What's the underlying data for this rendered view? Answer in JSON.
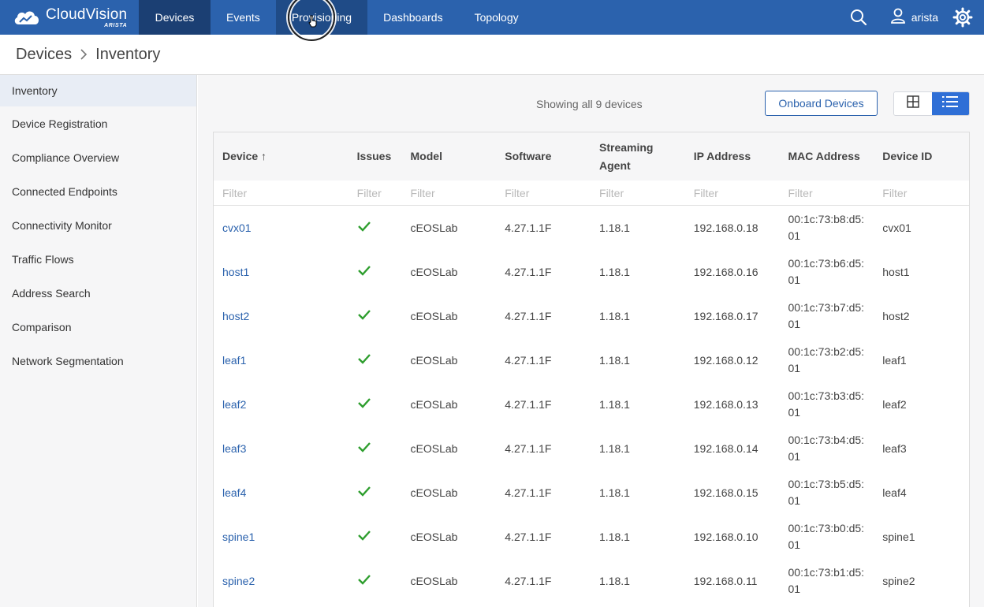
{
  "app": {
    "name": "CloudVision",
    "sub": "ARISTA"
  },
  "nav": {
    "tabs": [
      {
        "label": "Devices"
      },
      {
        "label": "Events"
      },
      {
        "label": "Provisioning"
      },
      {
        "label": "Dashboards"
      },
      {
        "label": "Topology"
      }
    ],
    "active": "Devices",
    "user": "arista"
  },
  "breadcrumb": {
    "section": "Devices",
    "page": "Inventory"
  },
  "sidebar": {
    "items": [
      {
        "label": "Inventory"
      },
      {
        "label": "Device Registration"
      },
      {
        "label": "Compliance Overview"
      },
      {
        "label": "Connected Endpoints"
      },
      {
        "label": "Connectivity Monitor"
      },
      {
        "label": "Traffic Flows"
      },
      {
        "label": "Address Search"
      },
      {
        "label": "Comparison"
      },
      {
        "label": "Network Segmentation"
      }
    ]
  },
  "toolbar": {
    "showing": "Showing all 9 devices",
    "onboard_label": "Onboard Devices"
  },
  "table": {
    "columns": [
      "Device",
      "Issues",
      "Model",
      "Software",
      "Streaming Agent",
      "IP Address",
      "MAC Address",
      "Device ID"
    ],
    "sort_indicator": "↑",
    "filter_placeholder": "Filter",
    "rows": [
      {
        "device": "cvx01",
        "model": "cEOSLab",
        "software": "4.27.1.1F",
        "agent": "1.18.1",
        "ip": "192.168.0.18",
        "mac": "00:1c:73:b8:d5:01",
        "id": "cvx01"
      },
      {
        "device": "host1",
        "model": "cEOSLab",
        "software": "4.27.1.1F",
        "agent": "1.18.1",
        "ip": "192.168.0.16",
        "mac": "00:1c:73:b6:d5:01",
        "id": "host1"
      },
      {
        "device": "host2",
        "model": "cEOSLab",
        "software": "4.27.1.1F",
        "agent": "1.18.1",
        "ip": "192.168.0.17",
        "mac": "00:1c:73:b7:d5:01",
        "id": "host2"
      },
      {
        "device": "leaf1",
        "model": "cEOSLab",
        "software": "4.27.1.1F",
        "agent": "1.18.1",
        "ip": "192.168.0.12",
        "mac": "00:1c:73:b2:d5:01",
        "id": "leaf1"
      },
      {
        "device": "leaf2",
        "model": "cEOSLab",
        "software": "4.27.1.1F",
        "agent": "1.18.1",
        "ip": "192.168.0.13",
        "mac": "00:1c:73:b3:d5:01",
        "id": "leaf2"
      },
      {
        "device": "leaf3",
        "model": "cEOSLab",
        "software": "4.27.1.1F",
        "agent": "1.18.1",
        "ip": "192.168.0.14",
        "mac": "00:1c:73:b4:d5:01",
        "id": "leaf3"
      },
      {
        "device": "leaf4",
        "model": "cEOSLab",
        "software": "4.27.1.1F",
        "agent": "1.18.1",
        "ip": "192.168.0.15",
        "mac": "00:1c:73:b5:d5:01",
        "id": "leaf4"
      },
      {
        "device": "spine1",
        "model": "cEOSLab",
        "software": "4.27.1.1F",
        "agent": "1.18.1",
        "ip": "192.168.0.10",
        "mac": "00:1c:73:b0:d5:01",
        "id": "spine1"
      },
      {
        "device": "spine2",
        "model": "cEOSLab",
        "software": "4.27.1.1F",
        "agent": "1.18.1",
        "ip": "192.168.0.11",
        "mac": "00:1c:73:b1:d5:01",
        "id": "spine2"
      }
    ]
  },
  "colors": {
    "nav_bg": "#2b62ad",
    "nav_active": "#1b3f73",
    "link": "#2b62ad",
    "ok": "#2e9e2e"
  },
  "icons": [
    "cloud-logo-icon",
    "search-icon",
    "user-icon",
    "gear-icon",
    "chevron-right-icon",
    "grid-view-icon",
    "list-view-icon",
    "check-icon",
    "pointer-hand-icon"
  ]
}
